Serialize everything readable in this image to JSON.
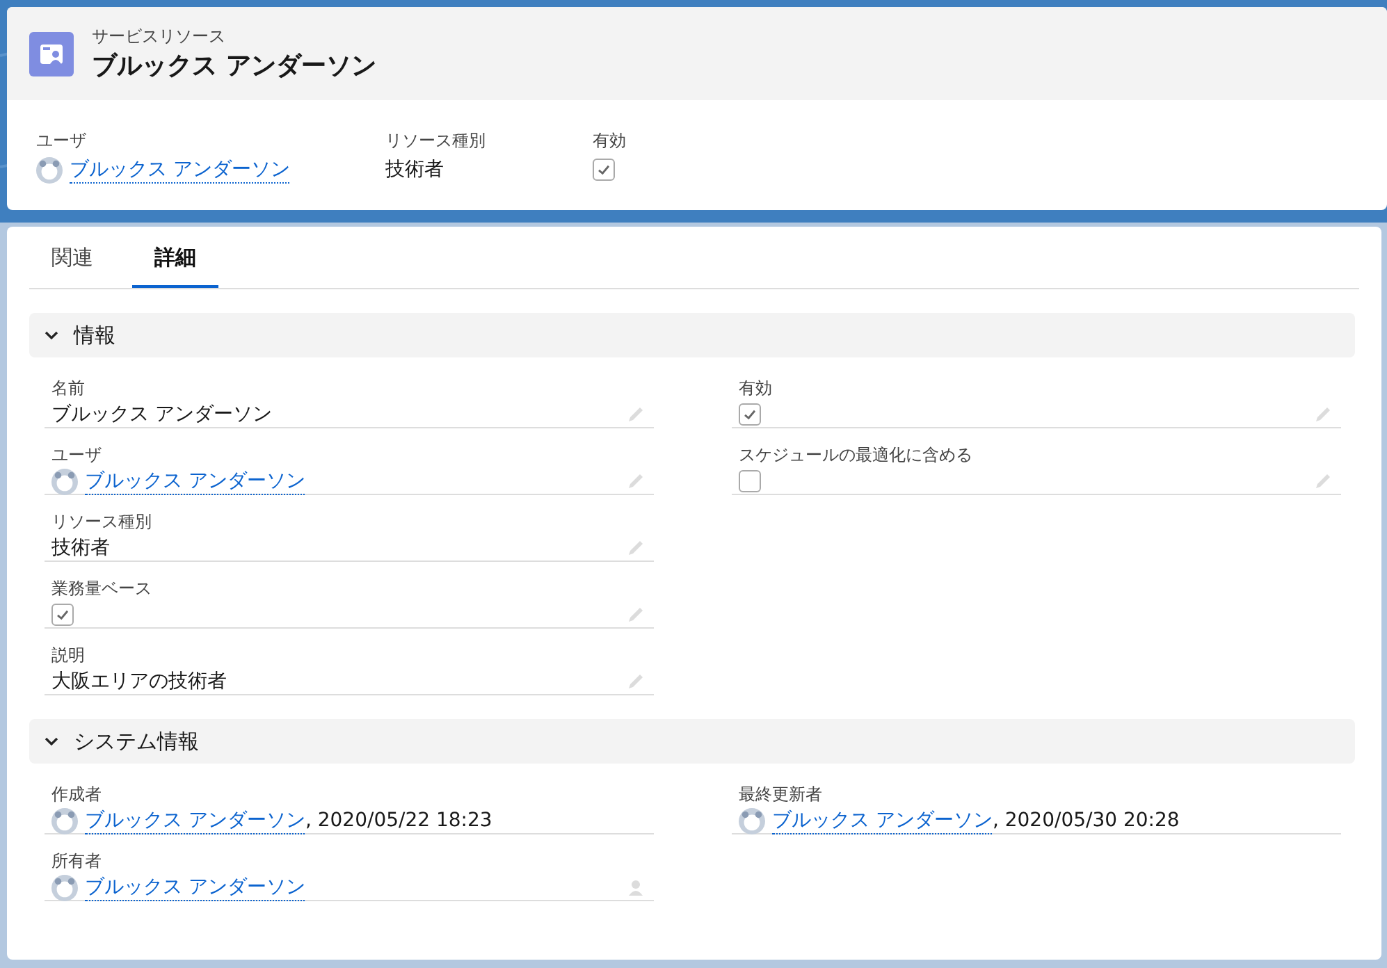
{
  "header": {
    "object_type": "サービスリソース",
    "title": "ブルックス アンダーソン",
    "fields": [
      {
        "label": "ユーザ",
        "kind": "link",
        "value": "ブルックス アンダーソン"
      },
      {
        "label": "リソース種別",
        "kind": "text",
        "value": "技術者"
      },
      {
        "label": "有効",
        "kind": "checkbox",
        "checked": true
      }
    ]
  },
  "tabs": [
    {
      "label": "関連",
      "selected": false
    },
    {
      "label": "詳細",
      "selected": true
    }
  ],
  "sections": [
    {
      "title": "情報",
      "expanded": true,
      "left": [
        {
          "label": "名前",
          "kind": "text",
          "value": "ブルックス アンダーソン",
          "editable": true
        },
        {
          "label": "ユーザ",
          "kind": "link",
          "value": "ブルックス アンダーソン",
          "editable": true
        },
        {
          "label": "リソース種別",
          "kind": "text",
          "value": "技術者",
          "editable": true
        },
        {
          "label": "業務量ベース",
          "kind": "checkbox",
          "checked": true,
          "editable": true
        },
        {
          "label": "説明",
          "kind": "text",
          "value": "大阪エリアの技術者",
          "editable": true
        }
      ],
      "right": [
        {
          "label": "有効",
          "kind": "checkbox",
          "checked": true,
          "editable": true
        },
        {
          "label": "スケジュールの最適化に含める",
          "kind": "checkbox",
          "checked": false,
          "editable": true
        }
      ]
    },
    {
      "title": "システム情報",
      "expanded": true,
      "left": [
        {
          "label": "作成者",
          "kind": "link",
          "value": "ブルックス アンダーソン",
          "suffix": ", 2020/05/22 18:23"
        },
        {
          "label": "所有者",
          "kind": "link",
          "value": "ブルックス アンダーソン",
          "owner_change": true
        }
      ],
      "right": [
        {
          "label": "最終更新者",
          "kind": "link",
          "value": "ブルックス アンダーソン",
          "suffix": ", 2020/05/30 20:28"
        }
      ]
    }
  ]
}
